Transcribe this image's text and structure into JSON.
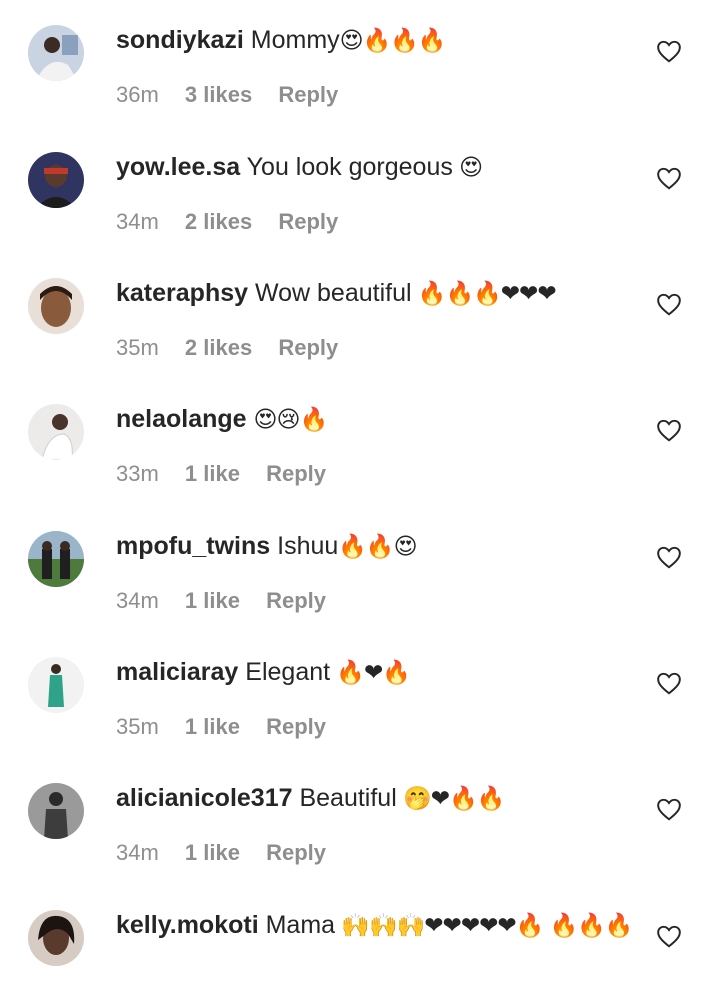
{
  "comments": [
    {
      "username": "sondiykazi",
      "text": "Mommy",
      "emoji": "😍🔥🔥🔥",
      "time": "36m",
      "likes": "3 likes",
      "reply": "Reply",
      "avatar_color": "#b8c4d6"
    },
    {
      "username": "yow.lee.sa",
      "text": "You look gorgeous",
      "emoji": " 😍",
      "time": "34m",
      "likes": "2 likes",
      "reply": "Reply",
      "avatar_color": "#3a3f6b"
    },
    {
      "username": "kateraphsy",
      "text": "Wow beautiful",
      "emoji": " 🔥🔥🔥❤❤❤",
      "time": "35m",
      "likes": "2 likes",
      "reply": "Reply",
      "avatar_color": "#a9714a"
    },
    {
      "username": "nelaolange",
      "text": "",
      "emoji": "😍😢🔥",
      "time": "33m",
      "likes": "1 like",
      "reply": "Reply",
      "avatar_color": "#d9d4cf"
    },
    {
      "username": "mpofu_twins",
      "text": "Ishuu",
      "emoji": "🔥🔥😍",
      "time": "34m",
      "likes": "1 like",
      "reply": "Reply",
      "avatar_color": "#5c7a4c"
    },
    {
      "username": "maliciaray",
      "text": "Elegant",
      "emoji": " 🔥❤🔥",
      "time": "35m",
      "likes": "1 like",
      "reply": "Reply",
      "avatar_color": "#e9e9e9"
    },
    {
      "username": "alicianicole317",
      "text": "Beautiful",
      "emoji": " 🤭❤🔥🔥",
      "time": "34m",
      "likes": "1 like",
      "reply": "Reply",
      "avatar_color": "#555555"
    },
    {
      "username": "kelly.mokoti",
      "text": "Mama",
      "emoji": " 🙌🙌🙌❤❤❤❤❤🔥 🔥🔥🔥",
      "time": "",
      "likes": "",
      "reply": "",
      "avatar_color": "#3b2c27"
    }
  ],
  "icons": {
    "like": "heart-outline-icon"
  },
  "colors": {
    "text": "#262626",
    "meta": "#8e8e8e",
    "background": "#ffffff"
  }
}
